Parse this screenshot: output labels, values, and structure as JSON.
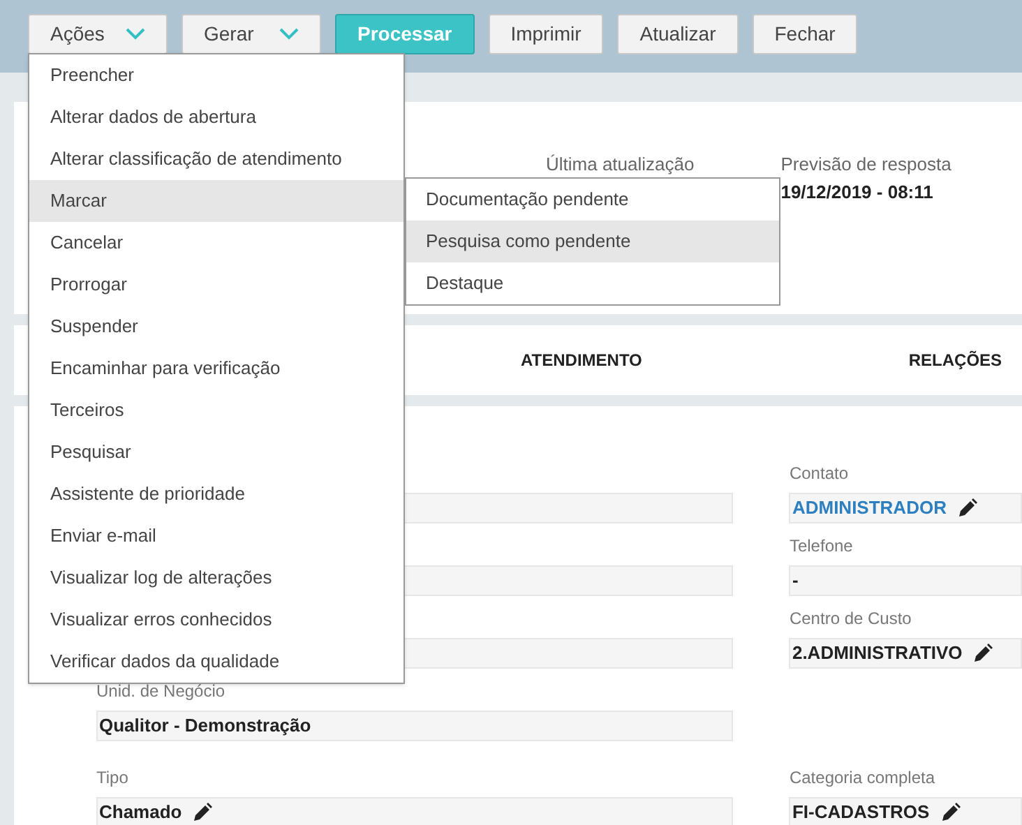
{
  "toolbar": {
    "buttons": [
      {
        "label": "Ações",
        "kind": "dropdown",
        "primary": false
      },
      {
        "label": "Gerar",
        "kind": "dropdown",
        "primary": false
      },
      {
        "label": "Processar",
        "kind": "plain",
        "primary": true
      },
      {
        "label": "Imprimir",
        "kind": "plain",
        "primary": false
      },
      {
        "label": "Atualizar",
        "kind": "plain",
        "primary": false
      },
      {
        "label": "Fechar",
        "kind": "plain",
        "primary": false
      }
    ]
  },
  "actions_menu": {
    "items": [
      {
        "label": "Preencher",
        "selected": false
      },
      {
        "label": "Alterar dados de abertura",
        "selected": false
      },
      {
        "label": "Alterar classificação de atendimento",
        "selected": false
      },
      {
        "label": "Marcar",
        "selected": true
      },
      {
        "label": "Cancelar",
        "selected": false
      },
      {
        "label": "Prorrogar",
        "selected": false
      },
      {
        "label": "Suspender",
        "selected": false
      },
      {
        "label": "Encaminhar para verificação",
        "selected": false
      },
      {
        "label": "Terceiros",
        "selected": false
      },
      {
        "label": "Pesquisar",
        "selected": false
      },
      {
        "label": "Assistente de prioridade",
        "selected": false
      },
      {
        "label": "Enviar e-mail",
        "selected": false
      },
      {
        "label": "Visualizar log de alterações",
        "selected": false
      },
      {
        "label": "Visualizar erros conhecidos",
        "selected": false
      },
      {
        "label": "Verificar dados da qualidade",
        "selected": false
      }
    ]
  },
  "submenu": {
    "items": [
      {
        "label": "Documentação pendente",
        "selected": false
      },
      {
        "label": "Pesquisa como pendente",
        "selected": true
      },
      {
        "label": "Destaque",
        "selected": false
      }
    ]
  },
  "header": {
    "last_update_label": "Última atualização",
    "forecast_label": "Previsão de resposta",
    "forecast_value": "19/12/2019 - 08:11"
  },
  "tabs": [
    {
      "label": "ATENDIMENTO"
    },
    {
      "label": "RELAÇÕES"
    }
  ],
  "form": {
    "left": [
      {
        "kind": "blank"
      },
      {
        "kind": "blank"
      },
      {
        "kind": "blank"
      },
      {
        "kind": "field",
        "label": "Unid. de Negócio",
        "value": "Qualitor - Demonstração",
        "editable": false
      },
      {
        "kind": "field",
        "label": "Tipo",
        "value": "Chamado",
        "editable": true
      }
    ],
    "right": [
      {
        "label": "Contato",
        "value": "ADMINISTRADOR",
        "editable": true,
        "link": true
      },
      {
        "label": "Telefone",
        "value": "-",
        "editable": false,
        "link": false
      },
      {
        "label": "Centro de Custo",
        "value": "2.ADMINISTRATIVO",
        "editable": true,
        "link": false
      },
      {
        "label": "Categoria completa",
        "value": "FI-CADASTROS",
        "editable": true,
        "link": false
      }
    ]
  }
}
